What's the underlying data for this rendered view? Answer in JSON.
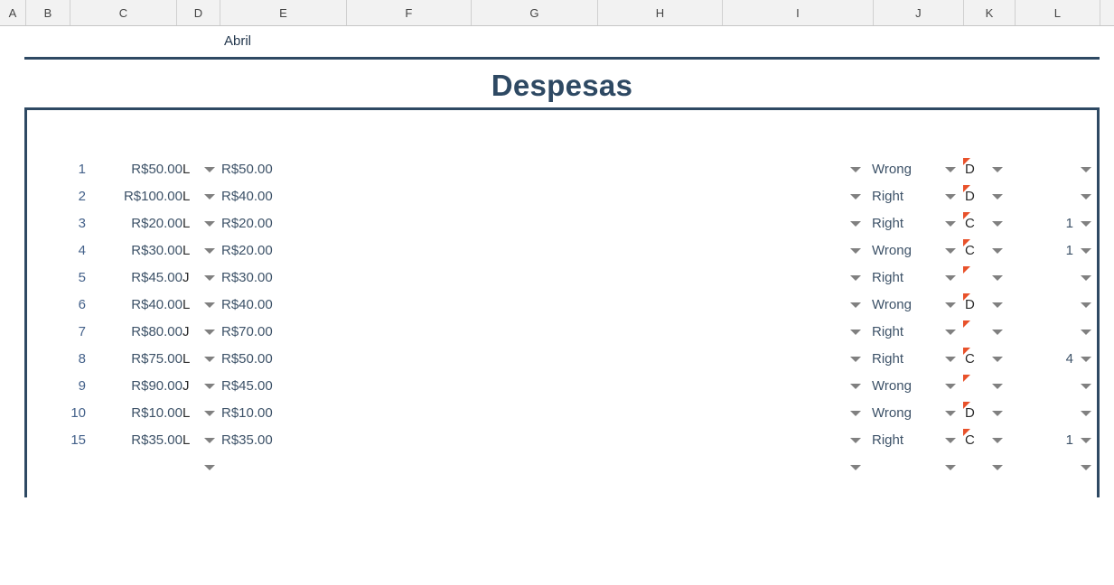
{
  "spreadsheet": {
    "columns": [
      "A",
      "B",
      "C",
      "D",
      "E",
      "F",
      "G",
      "H",
      "I",
      "J",
      "K",
      "L"
    ],
    "month_label": "Abril",
    "title": "Despesas",
    "accent_color": "#2e4963",
    "comment_marker_color": "#e8512a",
    "dropdown_icon": "filter-dropdown-arrow",
    "rows": [
      {
        "num": "1",
        "amount": "R$50.00",
        "person": "L",
        "paid": "R$50.00",
        "status": "Wrong",
        "code": "D",
        "count": ""
      },
      {
        "num": "2",
        "amount": "R$100.00",
        "person": "L",
        "paid": "R$40.00",
        "status": "Right",
        "code": "D",
        "count": ""
      },
      {
        "num": "3",
        "amount": "R$20.00",
        "person": "L",
        "paid": "R$20.00",
        "status": "Right",
        "code": "C",
        "count": "1"
      },
      {
        "num": "4",
        "amount": "R$30.00",
        "person": "L",
        "paid": "R$20.00",
        "status": "Wrong",
        "code": "C",
        "count": "1"
      },
      {
        "num": "5",
        "amount": "R$45.00",
        "person": "J",
        "paid": "R$30.00",
        "status": "Right",
        "code": "",
        "count": ""
      },
      {
        "num": "6",
        "amount": "R$40.00",
        "person": "L",
        "paid": "R$40.00",
        "status": "Wrong",
        "code": "D",
        "count": ""
      },
      {
        "num": "7",
        "amount": "R$80.00",
        "person": "J",
        "paid": "R$70.00",
        "status": "Right",
        "code": "",
        "count": ""
      },
      {
        "num": "8",
        "amount": "R$75.00",
        "person": "L",
        "paid": "R$50.00",
        "status": "Right",
        "code": "C",
        "count": "4"
      },
      {
        "num": "9",
        "amount": "R$90.00",
        "person": "J",
        "paid": "R$45.00",
        "status": "Wrong",
        "code": "",
        "count": ""
      },
      {
        "num": "10",
        "amount": "R$10.00",
        "person": "L",
        "paid": "R$10.00",
        "status": "Wrong",
        "code": "D",
        "count": ""
      },
      {
        "num": "15",
        "amount": "R$35.00",
        "person": "L",
        "paid": "R$35.00",
        "status": "Right",
        "code": "C",
        "count": "1"
      },
      {
        "num": "",
        "amount": "",
        "person": "",
        "paid": "",
        "status": "",
        "code": "",
        "count": ""
      }
    ]
  }
}
